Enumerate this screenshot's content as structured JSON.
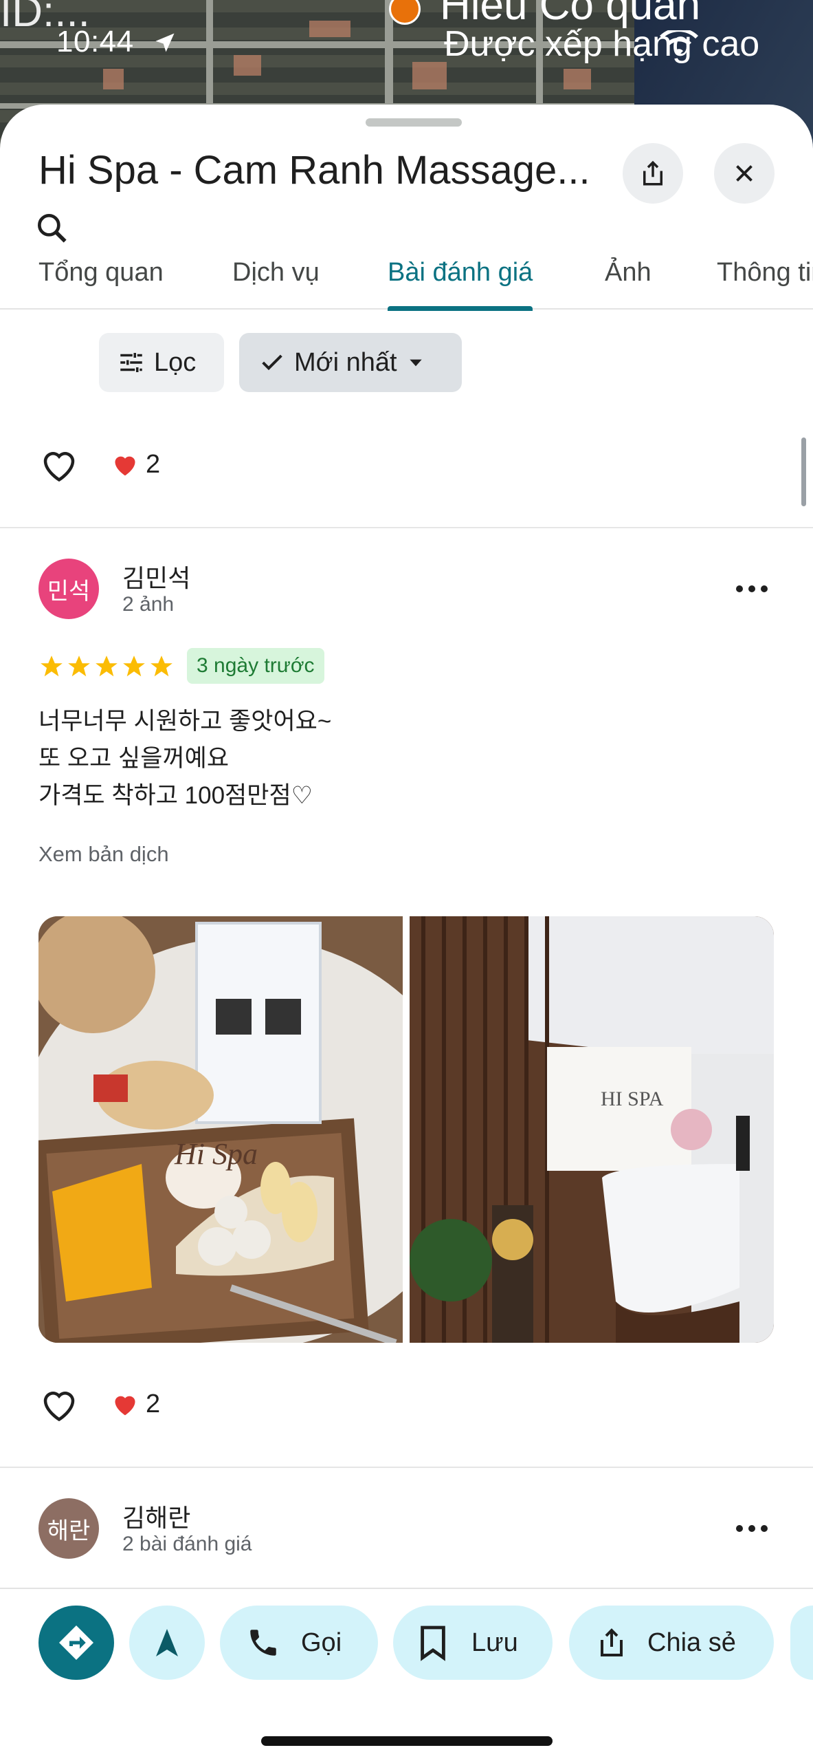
{
  "status": {
    "time": "10:44"
  },
  "map": {
    "label_left": "ID:...",
    "label_place": "Hieu Co quan",
    "label_rank": "Được xếp hạng cao"
  },
  "place": {
    "title": "Hi Spa - Cam Ranh Massage..."
  },
  "tabs": [
    {
      "label": "Tổng quan",
      "active": false
    },
    {
      "label": "Dịch vụ",
      "active": false
    },
    {
      "label": "Bài đánh giá",
      "active": true
    },
    {
      "label": "Ảnh",
      "active": false
    },
    {
      "label": "Thông tin",
      "active": false
    }
  ],
  "filters": {
    "filter_label": "Lọc",
    "sort_label": "Mới nhất"
  },
  "prev_review": {
    "reaction_count": "2"
  },
  "review1": {
    "avatar_text": "민석",
    "avatar_color": "#e8437c",
    "name": "김민석",
    "meta": "2 ảnh",
    "rating": 5,
    "time_badge": "3 ngày trước",
    "lines": [
      "너무너무 시원하고 좋앗어요~",
      "또 오고 싶을꺼예요",
      "가격도 착하고 100점만점♡"
    ],
    "translate_label": "Xem bản dịch",
    "reaction_count": "2",
    "photo1_lettering": "Hi Spa",
    "photo2_lettering": "HI SPA"
  },
  "review2": {
    "avatar_text": "해란",
    "avatar_color": "#8d6e63",
    "name": "김해란",
    "meta": "2 bài đánh giá"
  },
  "actions": {
    "call": "Gọi",
    "save": "Lưu",
    "share": "Chia sẻ"
  },
  "colors": {
    "accent": "#0b7282",
    "action_bg": "#d3f3fa",
    "star": "#fbbc04"
  }
}
